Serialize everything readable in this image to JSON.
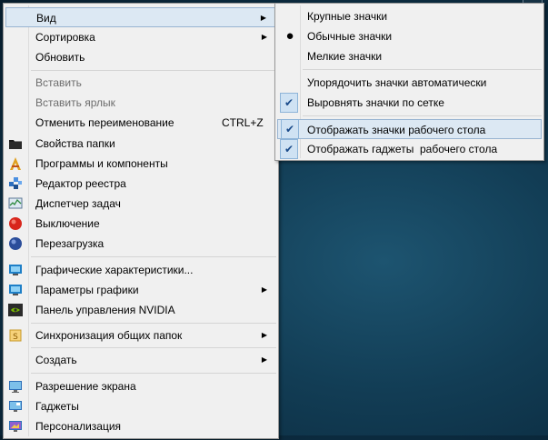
{
  "context_menu": {
    "items": [
      {
        "label": "Вид",
        "submenu": true
      },
      {
        "label": "Сортировка",
        "submenu": true
      },
      {
        "label": "Обновить"
      },
      {
        "label": "Вставить",
        "disabled": true
      },
      {
        "label": "Вставить ярлык",
        "disabled": true
      },
      {
        "label": "Отменить переименование",
        "shortcut": "CTRL+Z"
      },
      {
        "label": "Свойства папки",
        "icon": "folder-icon"
      },
      {
        "label": "Программы и компоненты",
        "icon": "programs-icon"
      },
      {
        "label": "Редактор реестра",
        "icon": "registry-icon"
      },
      {
        "label": "Диспетчер задач",
        "icon": "task-manager-icon"
      },
      {
        "label": "Выключение",
        "icon": "shutdown-icon"
      },
      {
        "label": "Перезагрузка",
        "icon": "restart-icon"
      },
      {
        "label": "Графические характеристики...",
        "icon": "graphics-icon"
      },
      {
        "label": "Параметры графики",
        "icon": "graphics-options-icon",
        "submenu": true
      },
      {
        "label": "Панель управления NVIDIA",
        "icon": "nvidia-icon"
      },
      {
        "label": "Синхронизация общих папок",
        "icon": "sync-folder-icon",
        "submenu": true
      },
      {
        "label": "Создать",
        "submenu": true
      },
      {
        "label": "Разрешение экрана",
        "icon": "screen-resolution-icon"
      },
      {
        "label": "Гаджеты",
        "icon": "gadgets-icon"
      },
      {
        "label": "Персонализация",
        "icon": "personalization-icon"
      }
    ]
  },
  "view_submenu": {
    "items": [
      {
        "label": "Крупные значки"
      },
      {
        "label": "Обычные значки",
        "selected": "radio"
      },
      {
        "label": "Мелкие значки"
      },
      {
        "label": "Упорядочить значки автоматически"
      },
      {
        "label": "Выровнять значки по сетке",
        "checked": true
      },
      {
        "label": "Отображать значки рабочего стола",
        "checked": true,
        "highlighted": true
      },
      {
        "label": "Отображать гаджеты  рабочего стола",
        "checked": true
      }
    ]
  },
  "colors": {
    "menu_bg": "#f0f0f0",
    "highlight_bg": "#dce8f3",
    "highlight_border": "#99b4d1",
    "disabled_text": "#6d6d6d",
    "desktop": "#0b2a3e"
  }
}
